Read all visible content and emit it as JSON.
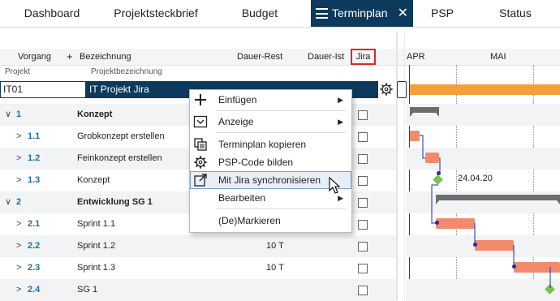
{
  "tabs": [
    {
      "label": "Dashboard"
    },
    {
      "label": "Projektsteckbrief"
    },
    {
      "label": "Budget"
    },
    {
      "label": "Terminplan"
    },
    {
      "label": "PSP"
    },
    {
      "label": "Status"
    }
  ],
  "header": {
    "vorgang": "Vorgang",
    "plus": "+",
    "bezeichnung": "Bezeichnung",
    "dauer_rest": "Dauer-Rest",
    "dauer_ist": "Dauer-Ist",
    "jira": "Jira",
    "projekt": "Projekt",
    "projektbezeichnung": "Projektbezeichnung"
  },
  "project": {
    "id": "IT01",
    "name": "IT Projekt Jira"
  },
  "rows": [
    {
      "chev": "∨",
      "id": "1",
      "name": "Konzept",
      "dauer": ""
    },
    {
      "chev": ">",
      "id": "1.1",
      "name": "Grobkonzept erstellen",
      "dauer": ""
    },
    {
      "chev": ">",
      "id": "1.2",
      "name": "Feinkonzept erstellen",
      "dauer": ""
    },
    {
      "chev": ">",
      "id": "1.3",
      "name": "Konzept",
      "dauer": ""
    },
    {
      "chev": "∨",
      "id": "2",
      "name": "Entwicklung SG 1",
      "dauer": ""
    },
    {
      "chev": ">",
      "id": "2.1",
      "name": "Sprint 1.1",
      "dauer": ""
    },
    {
      "chev": ">",
      "id": "2.2",
      "name": "Sprint 1.2",
      "dauer": "10 T"
    },
    {
      "chev": ">",
      "id": "2.3",
      "name": "Sprint 1.3",
      "dauer": "10 T"
    },
    {
      "chev": ">",
      "id": "2.4",
      "name": "SG 1",
      "dauer": ""
    }
  ],
  "gantt": {
    "months": [
      "APR",
      "MAI"
    ],
    "milestone_label": "24.04.20"
  },
  "menu": {
    "items": [
      {
        "label": "Einfügen",
        "icon": "plus-icon",
        "submenu": true
      },
      {
        "label": "Anzeige",
        "icon": "chevron-box-icon",
        "submenu": true
      },
      {
        "label": "Terminplan kopieren",
        "icon": "copy-icon",
        "submenu": false
      },
      {
        "label": "PSP-Code bilden",
        "icon": "gear-icon",
        "submenu": false
      },
      {
        "label": "Mit Jira synchronisieren",
        "icon": "external-link-icon",
        "submenu": false
      },
      {
        "label": "Bearbeiten",
        "icon": "",
        "submenu": true
      },
      {
        "label": "(De)Markieren",
        "icon": "",
        "submenu": false
      }
    ]
  },
  "colors": {
    "accent": "#0d3a5c",
    "task_bar": "#f28b6e",
    "project_bar": "#f2a03a",
    "milestone": "#7cc24b",
    "summary": "#6d6d6d",
    "jira_highlight": "#d42a2a"
  }
}
